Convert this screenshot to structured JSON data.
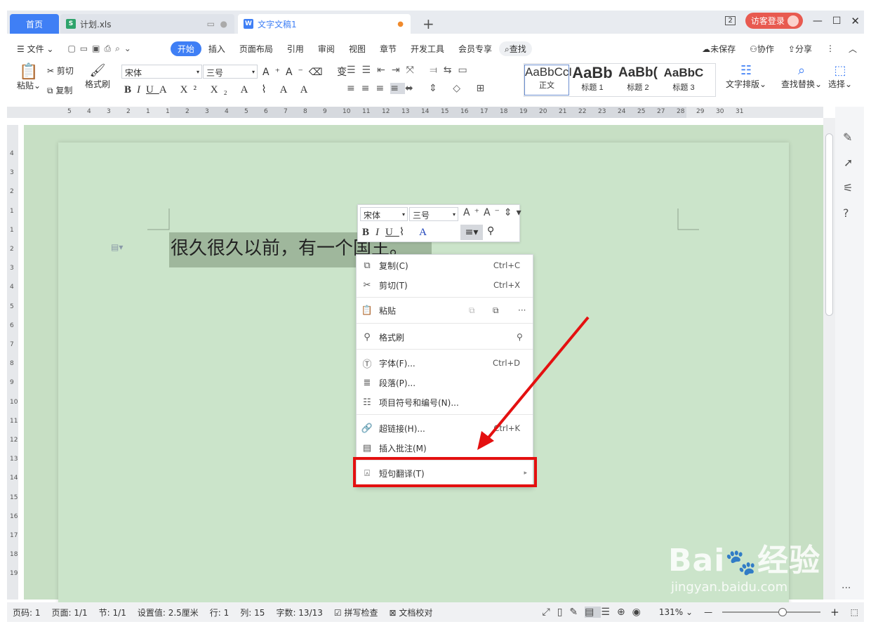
{
  "tabs": {
    "home": "首页",
    "xls": "计划.xls",
    "doc": "文字文稿1",
    "count": "2",
    "login": "访客登录"
  },
  "menu": {
    "file": "文件",
    "items": [
      "开始",
      "插入",
      "页面布局",
      "引用",
      "审阅",
      "视图",
      "章节",
      "开发工具",
      "会员专享"
    ],
    "search": "查找",
    "unsaved": "未保存",
    "collab": "协作",
    "share": "分享"
  },
  "ribbon": {
    "paste": "粘贴",
    "cut": "剪切",
    "copy": "复制",
    "format_painter": "格式刷",
    "font": "宋体",
    "size": "三号",
    "styles": [
      {
        "sample": "AaBbCcI",
        "name": "正文"
      },
      {
        "sample": "AaBb",
        "name": "标题 1"
      },
      {
        "sample": "AaBb(",
        "name": "标题 2"
      },
      {
        "sample": "AaBbC",
        "name": "标题 3"
      }
    ],
    "text_layout": "文字排版",
    "find_replace": "查找替换",
    "select": "选择"
  },
  "ruler_h": [
    "5",
    "4",
    "3",
    "2",
    "1",
    "1",
    "2",
    "3",
    "4",
    "5",
    "6",
    "7",
    "8",
    "9",
    "10",
    "11",
    "12",
    "13",
    "14",
    "15",
    "16",
    "17",
    "18",
    "19",
    "20",
    "21",
    "22",
    "23",
    "24",
    "25",
    "27",
    "28",
    "29",
    "30",
    "31"
  ],
  "ruler_v": [
    "4",
    "3",
    "2",
    "1",
    "1",
    "2",
    "3",
    "4",
    "5",
    "6",
    "7",
    "8",
    "9",
    "10",
    "11",
    "12",
    "13",
    "14",
    "15",
    "16",
    "17",
    "18",
    "19"
  ],
  "document": {
    "text": "很久很久以前，有一个国王。"
  },
  "mini_toolbar": {
    "font": "宋体",
    "size": "三号"
  },
  "context_menu": {
    "copy": {
      "label": "复制(C)",
      "shortcut": "Ctrl+C"
    },
    "cut": {
      "label": "剪切(T)",
      "shortcut": "Ctrl+X"
    },
    "paste": {
      "label": "粘贴"
    },
    "format_painter": {
      "label": "格式刷"
    },
    "font": {
      "label": "字体(F)...",
      "shortcut": "Ctrl+D"
    },
    "paragraph": {
      "label": "段落(P)..."
    },
    "bullets": {
      "label": "项目符号和编号(N)..."
    },
    "hyperlink": {
      "label": "超链接(H)...",
      "shortcut": "Ctrl+K"
    },
    "comment": {
      "label": "插入批注(M)"
    },
    "translate": {
      "label": "短句翻译(T)"
    }
  },
  "status": {
    "page_no": "页码: 1",
    "pages": "页面: 1/1",
    "section": "节: 1/1",
    "setting": "设置值: 2.5厘米",
    "row": "行: 1",
    "col": "列: 15",
    "words": "字数: 13/13",
    "spell": "拼写检查",
    "proof": "文档校对",
    "zoom": "131%"
  },
  "watermark": {
    "brand": "Bai",
    "brand2": "经验",
    "url": "jingyan.baidu.com"
  },
  "colors": {
    "accent": "#3f7ff5",
    "login": "#e85a50",
    "highlight_box": "#e41010",
    "arrow": "#e41010",
    "canvas": "#c7dfc4"
  }
}
